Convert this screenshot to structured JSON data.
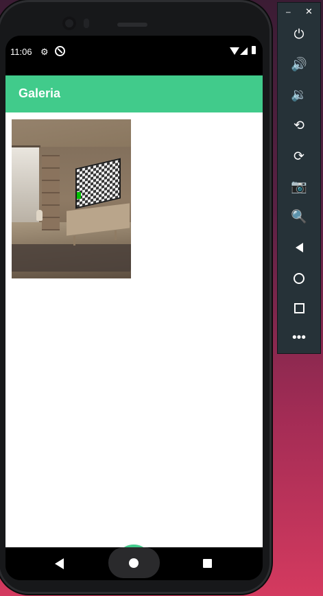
{
  "status_bar": {
    "time": "11:06"
  },
  "app_bar": {
    "title": "Galeria"
  },
  "gallery": {
    "photos": [
      {
        "alt": "Living room with TV"
      }
    ]
  },
  "colors": {
    "primary": "#41cb8b",
    "toolbar": "#263238"
  },
  "emulator_toolbar": {
    "items": [
      {
        "icon": "power-icon"
      },
      {
        "icon": "volume-up-icon"
      },
      {
        "icon": "volume-down-icon"
      },
      {
        "icon": "rotate-left-icon"
      },
      {
        "icon": "rotate-right-icon"
      },
      {
        "icon": "camera-icon"
      },
      {
        "icon": "zoom-icon"
      },
      {
        "icon": "back-icon"
      },
      {
        "icon": "home-icon"
      },
      {
        "icon": "overview-icon"
      },
      {
        "icon": "more-icon"
      }
    ]
  },
  "fab": {
    "icon": "camera-icon"
  }
}
